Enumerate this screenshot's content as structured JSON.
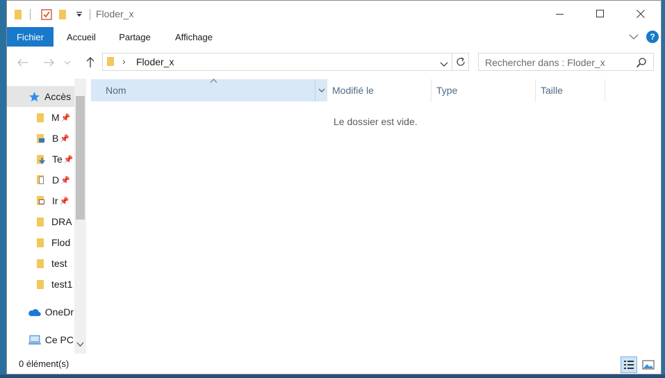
{
  "window": {
    "title": "Floder_x"
  },
  "quick_access_toolbar": {
    "icons": [
      "folder-icon",
      "properties-checkbox-icon",
      "new-folder-icon",
      "customize-dropdown-icon"
    ]
  },
  "window_controls": {
    "minimize": "—",
    "maximize": "☐",
    "close": "✕"
  },
  "ribbon": {
    "tabs": [
      "Fichier",
      "Accueil",
      "Partage",
      "Affichage"
    ],
    "active_tab": "Fichier",
    "help": "?"
  },
  "navigation": {
    "back": "←",
    "forward": "→",
    "recent": "⌄",
    "up": "↑"
  },
  "address": {
    "separator": "›",
    "path": "Floder_x",
    "dropdown": "⌄",
    "refresh": "⟳"
  },
  "search": {
    "placeholder": "Rechercher dans : Floder_x",
    "icon": "search-icon"
  },
  "nav_pane": {
    "items": [
      {
        "label": "Accès",
        "icon": "star-icon",
        "pinned": false
      },
      {
        "label": "M",
        "icon": "folder-icon",
        "pinned": true
      },
      {
        "label": "B",
        "icon": "desktop-folder-icon",
        "pinned": true
      },
      {
        "label": "Te",
        "icon": "downloads-folder-icon",
        "pinned": true
      },
      {
        "label": "D",
        "icon": "documents-folder-icon",
        "pinned": true
      },
      {
        "label": "Ir",
        "icon": "pictures-folder-icon",
        "pinned": true
      },
      {
        "label": "DRA",
        "icon": "folder-icon",
        "pinned": false
      },
      {
        "label": "Flod",
        "icon": "folder-icon",
        "pinned": false
      },
      {
        "label": "test",
        "icon": "folder-icon",
        "pinned": false
      },
      {
        "label": "test1",
        "icon": "folder-icon",
        "pinned": false
      },
      {
        "label": "OneDr",
        "icon": "onedrive-cloud-icon",
        "pinned": false
      },
      {
        "label": "Ce PC",
        "icon": "computer-icon",
        "pinned": false
      }
    ]
  },
  "columns": [
    "Nom",
    "Modifié le",
    "Type",
    "Taille"
  ],
  "sorted_column": "Nom",
  "empty_message": "Le dossier est vide.",
  "status_bar": {
    "item_count": "0 élément(s)"
  },
  "colors": {
    "accent": "#1979ca",
    "selected_header": "#d9e8f7",
    "folder": "#f3c75b"
  }
}
